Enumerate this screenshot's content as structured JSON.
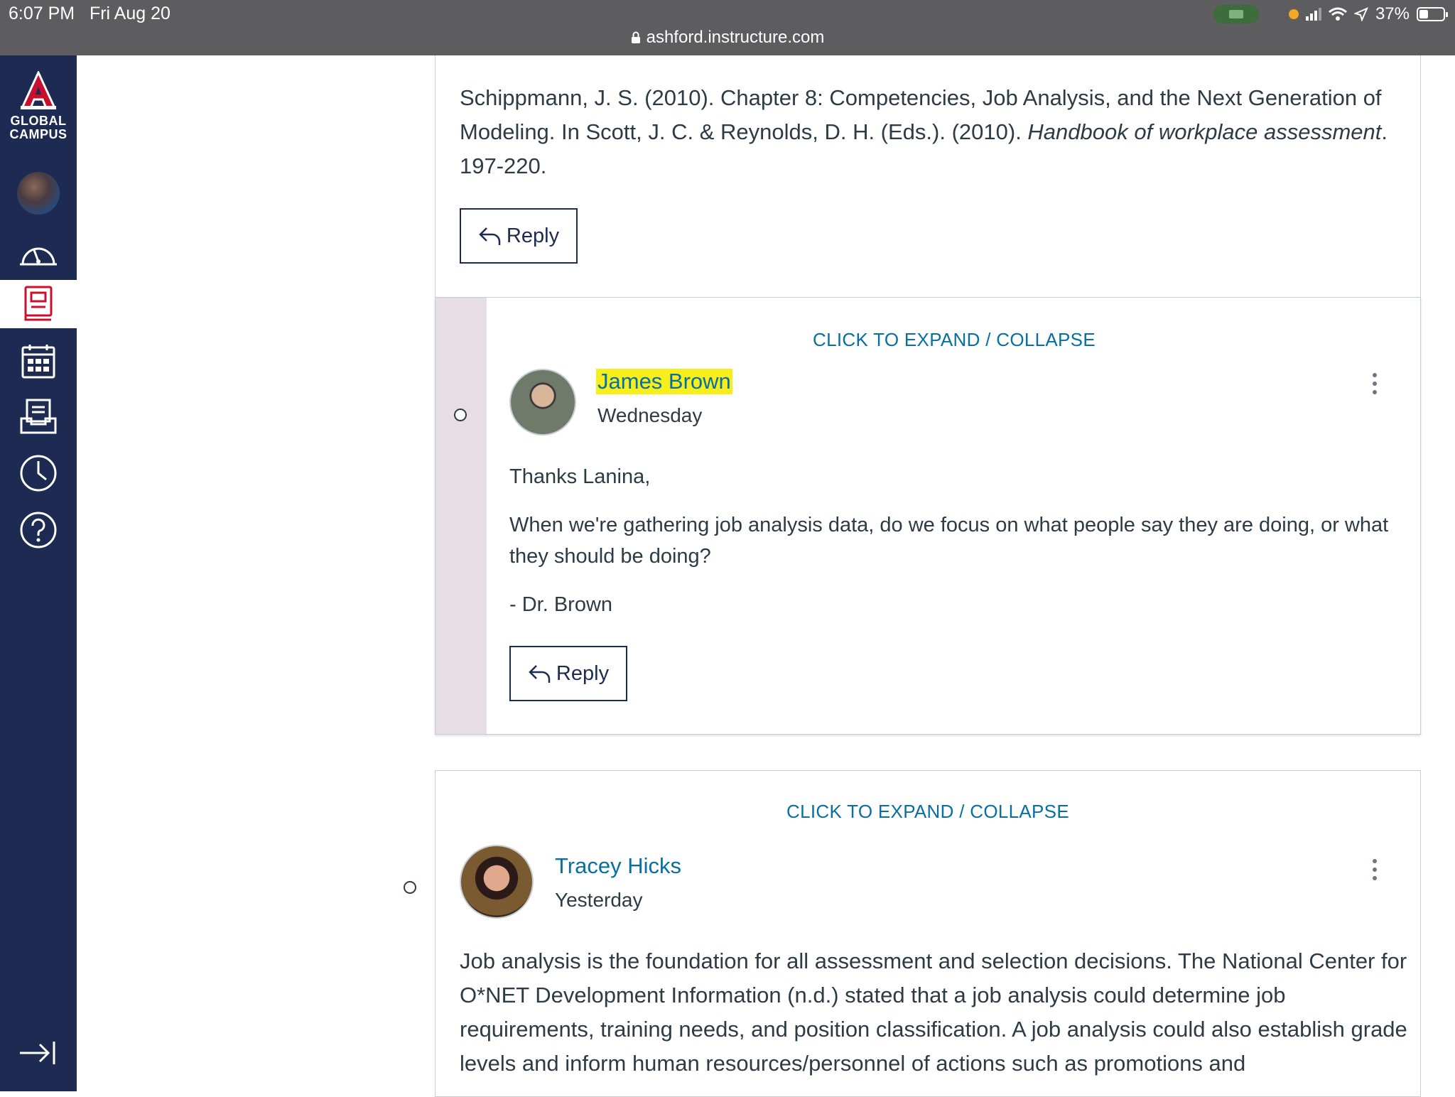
{
  "status_bar": {
    "time": "6:07 PM",
    "date": "Fri Aug 20",
    "url": "ashford.instructure.com",
    "battery": "37%"
  },
  "nav": {
    "logo_line1": "GLOBAL",
    "logo_line2": "CAMPUS",
    "items": [
      "dashboard",
      "courses",
      "calendar",
      "inbox",
      "history",
      "help"
    ],
    "active": "courses"
  },
  "top_post": {
    "citation_part1": "Schippmann, J. S. (2010). Chapter 8: Competencies, Job Analysis, and the Next Generation of Modeling. In Scott, J. C. & Reynolds, D. H. (Eds.). (2010). ",
    "citation_italic": "Handbook of workplace assessment",
    "citation_part2": ". 197-220.",
    "reply_label": "Reply"
  },
  "reply_brown": {
    "expand_label": "CLICK TO EXPAND / COLLAPSE",
    "author": "James Brown",
    "when": "Wednesday",
    "greeting": "Thanks Lanina,",
    "question": "When we're gathering job analysis data, do we focus on what people say they are doing, or what they should be doing?",
    "signature": "- Dr. Brown",
    "reply_label": "Reply"
  },
  "post_hicks": {
    "expand_label": "CLICK TO EXPAND / COLLAPSE",
    "author": "Tracey Hicks",
    "when": "Yesterday",
    "body": "Job analysis is the foundation for all assessment and selection decisions. The National Center for O*NET Development Information (n.d.) stated that a job analysis could determine job requirements, training needs, and position classification.  A job analysis could also establish grade levels and inform human resources/personnel of actions such as promotions and"
  }
}
